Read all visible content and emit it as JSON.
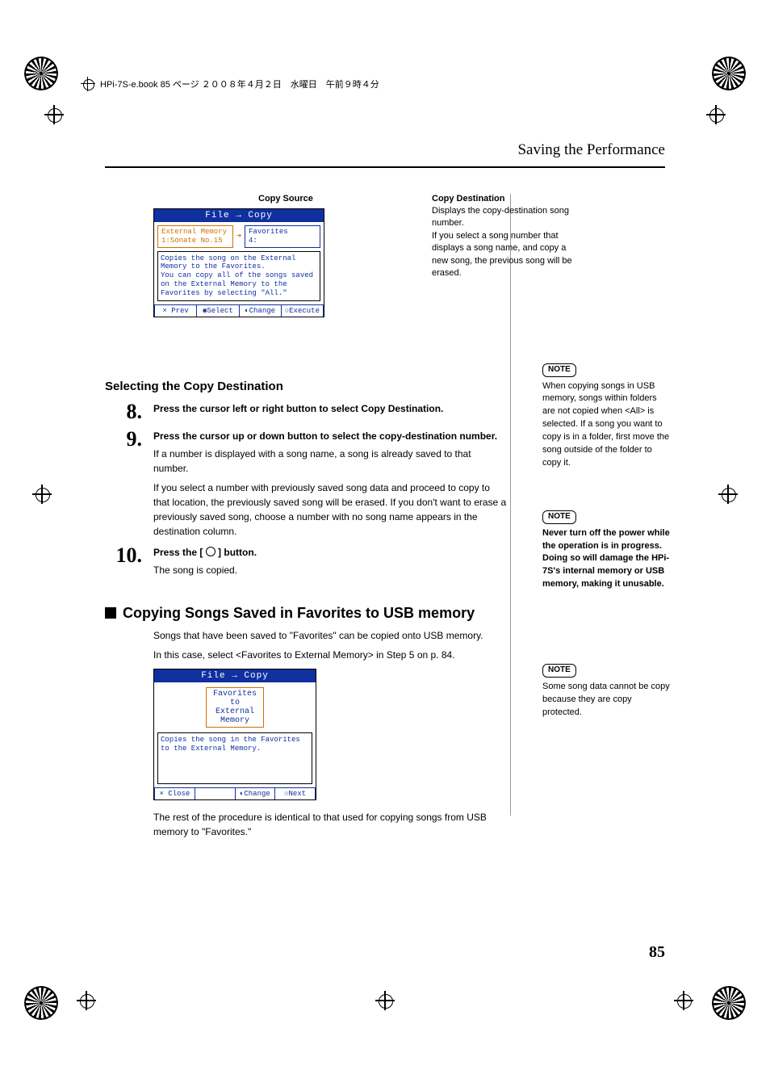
{
  "header_line": "HPi-7S-e.book  85 ページ  ２００８年４月２日　水曜日　午前９時４分",
  "page_title": "Saving the Performance",
  "caption_left": "Copy Source",
  "caption_right_h": "Copy Destination",
  "caption_right_t": "Displays the copy-destination song number.\nIf you select a song number that displays a song name, and copy a new song, the previous song will be erased.",
  "shot1": {
    "title": "File  →  Copy",
    "src_top": "External Memory",
    "src_bot": "1:Sonate No.15",
    "dst_top": "Favorites",
    "dst_bot": "4:",
    "msg": "Copies the song on the External Memory to the Favorites.\nYou can copy all of the songs saved on the External Memory to the Favorites by selecting \"All.\"",
    "foot": [
      "× Prev",
      "◉Select",
      "◐Change",
      "○Execute"
    ]
  },
  "section_h": "Selecting the Copy Destination",
  "step8": {
    "num": "8.",
    "lead": "Press the cursor left or right button to select Copy Destination."
  },
  "step9": {
    "num": "9.",
    "lead": "Press the cursor up or down button to select the copy-destination number.",
    "body1": "If a number is displayed with a song name, a song is already saved to that number.",
    "body2": "If you select a number with previously saved song data and proceed to copy to that location, the previously saved song will be erased. If you don't want to erase a previously saved song, choose a number with no song name appears in the destination column."
  },
  "step10": {
    "num": "10.",
    "lead_a": "Press the [",
    "lead_b": "] button.",
    "body": "The song is copied."
  },
  "sub_h": "Copying Songs Saved in Favorites to USB memory",
  "sub_p1": "Songs that have been saved to \"Favorites\" can be copied onto USB memory.",
  "sub_p2": "In this case, select <Favorites to External Memory> in Step 5 on p. 84.",
  "shot2": {
    "title": "File  →  Copy",
    "box": "Favorites\nto\nExternal\nMemory",
    "msg": "Copies the song in the Favorites to the External Memory.",
    "foot": [
      "× Close",
      "",
      "◐Change",
      "○Next"
    ]
  },
  "sub_p3": "The rest of the procedure is identical to that used for copying songs from USB memory to \"Favorites.\"",
  "notes": {
    "label": "NOTE",
    "n1": "When copying songs in USB memory, songs within folders are not copied when <All> is selected. If a song you want to copy is in a folder, first move the song outside of the folder to copy it.",
    "n2": "Never turn off the power while the operation is in progress. Doing so will damage the HPi-7S's internal memory or USB memory, making it unusable.",
    "n3": "Some song data cannot be copy because they are copy protected."
  },
  "page_num": "85"
}
